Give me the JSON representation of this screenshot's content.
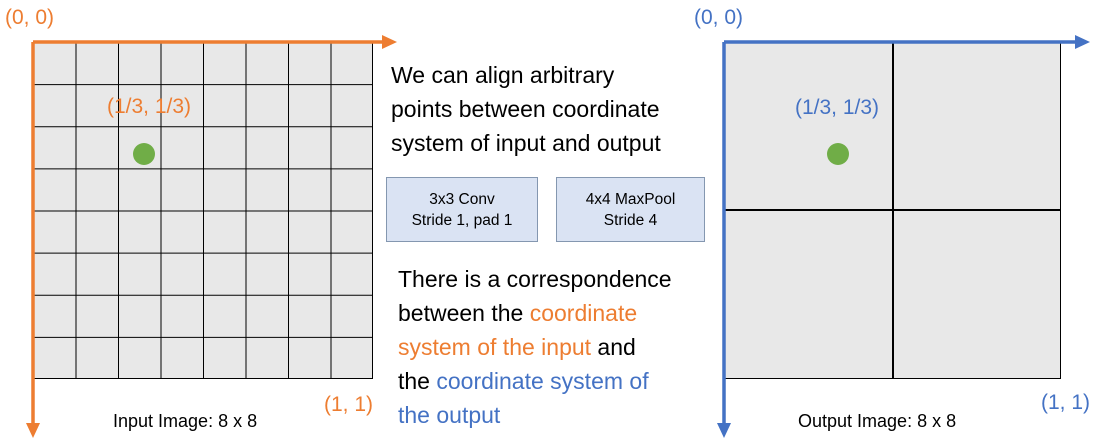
{
  "left_panel": {
    "origin_label": "(0, 0)",
    "point_label": "(1/3, 1/3)",
    "end_label": "(1, 1)",
    "caption": "Input Image: 8 x 8",
    "grid_size": 8
  },
  "right_panel": {
    "origin_label": "(0, 0)",
    "point_label": "(1/3, 1/3)",
    "end_label": "(1, 1)",
    "caption": "Output Image: 8 x 8",
    "grid_size": 2
  },
  "middle": {
    "intro_lines": [
      "We can align arbitrary",
      "points between coordinate",
      "system of input and output"
    ],
    "conv_box": {
      "line1": "3x3 Conv",
      "line2": "Stride 1, pad 1"
    },
    "pool_box": {
      "line1": "4x4 MaxPool",
      "line2": "Stride 4"
    },
    "correspondence": {
      "l1": "There is a correspondence",
      "l2": "between the ",
      "l2_orange": "coordinate",
      "l3_orange": "system of the input",
      "l3": " and",
      "l4": "the ",
      "l4_blue": "coordinate system of",
      "l5_blue": "the output"
    }
  },
  "colors": {
    "input_axis": "#ED7D31",
    "output_axis": "#4472C4",
    "point": "#70AD47",
    "grid_fill": "#e8e8e8",
    "box_fill": "#dae3f3"
  }
}
